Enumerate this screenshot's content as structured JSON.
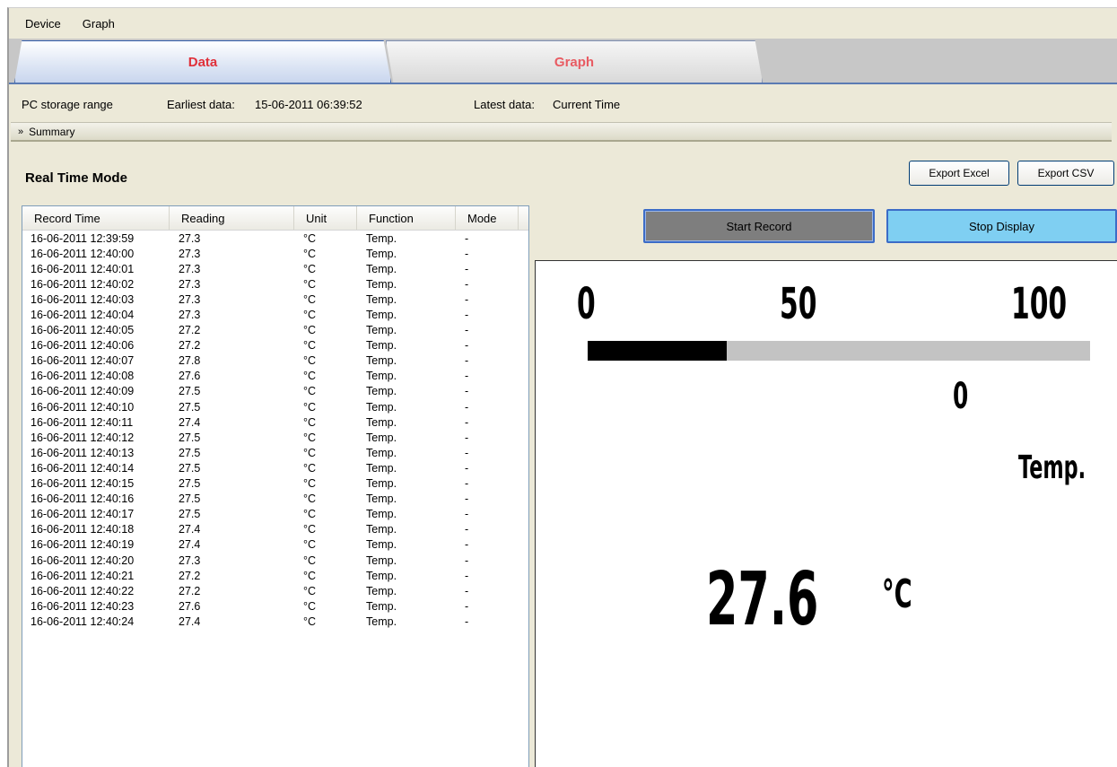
{
  "menu": {
    "items": [
      "Device",
      "Graph"
    ]
  },
  "tabs": {
    "data_label": "Data",
    "graph_label": "Graph"
  },
  "range": {
    "label": "PC storage range",
    "earliest_label": "Earliest data:",
    "earliest_value": "15-06-2011 06:39:52",
    "latest_label": "Latest data:",
    "latest_value": "Current Time"
  },
  "summary": {
    "label": "Summary",
    "chevron": "chevron-double-down-icon"
  },
  "mode_title": "Real Time Mode",
  "buttons": {
    "export_excel": "Export Excel",
    "export_csv": "Export CSV",
    "start_record": "Start Record",
    "stop_display": "Stop Display"
  },
  "table": {
    "columns": [
      "Record Time",
      "Reading",
      "Unit",
      "Function",
      "Mode"
    ],
    "rows": [
      [
        "16-06-2011 12:39:59",
        "27.3",
        "°C",
        "Temp.",
        "-"
      ],
      [
        "16-06-2011 12:40:00",
        "27.3",
        "°C",
        "Temp.",
        "-"
      ],
      [
        "16-06-2011 12:40:01",
        "27.3",
        "°C",
        "Temp.",
        "-"
      ],
      [
        "16-06-2011 12:40:02",
        "27.3",
        "°C",
        "Temp.",
        "-"
      ],
      [
        "16-06-2011 12:40:03",
        "27.3",
        "°C",
        "Temp.",
        "-"
      ],
      [
        "16-06-2011 12:40:04",
        "27.3",
        "°C",
        "Temp.",
        "-"
      ],
      [
        "16-06-2011 12:40:05",
        "27.2",
        "°C",
        "Temp.",
        "-"
      ],
      [
        "16-06-2011 12:40:06",
        "27.2",
        "°C",
        "Temp.",
        "-"
      ],
      [
        "16-06-2011 12:40:07",
        "27.8",
        "°C",
        "Temp.",
        "-"
      ],
      [
        "16-06-2011 12:40:08",
        "27.6",
        "°C",
        "Temp.",
        "-"
      ],
      [
        "16-06-2011 12:40:09",
        "27.5",
        "°C",
        "Temp.",
        "-"
      ],
      [
        "16-06-2011 12:40:10",
        "27.5",
        "°C",
        "Temp.",
        "-"
      ],
      [
        "16-06-2011 12:40:11",
        "27.4",
        "°C",
        "Temp.",
        "-"
      ],
      [
        "16-06-2011 12:40:12",
        "27.5",
        "°C",
        "Temp.",
        "-"
      ],
      [
        "16-06-2011 12:40:13",
        "27.5",
        "°C",
        "Temp.",
        "-"
      ],
      [
        "16-06-2011 12:40:14",
        "27.5",
        "°C",
        "Temp.",
        "-"
      ],
      [
        "16-06-2011 12:40:15",
        "27.5",
        "°C",
        "Temp.",
        "-"
      ],
      [
        "16-06-2011 12:40:16",
        "27.5",
        "°C",
        "Temp.",
        "-"
      ],
      [
        "16-06-2011 12:40:17",
        "27.5",
        "°C",
        "Temp.",
        "-"
      ],
      [
        "16-06-2011 12:40:18",
        "27.4",
        "°C",
        "Temp.",
        "-"
      ],
      [
        "16-06-2011 12:40:19",
        "27.4",
        "°C",
        "Temp.",
        "-"
      ],
      [
        "16-06-2011 12:40:20",
        "27.3",
        "°C",
        "Temp.",
        "-"
      ],
      [
        "16-06-2011 12:40:21",
        "27.2",
        "°C",
        "Temp.",
        "-"
      ],
      [
        "16-06-2011 12:40:22",
        "27.2",
        "°C",
        "Temp.",
        "-"
      ],
      [
        "16-06-2011 12:40:23",
        "27.6",
        "°C",
        "Temp.",
        "-"
      ],
      [
        "16-06-2011 12:40:24",
        "27.4",
        "°C",
        "Temp.",
        "-"
      ]
    ]
  },
  "display": {
    "scale_min": "0",
    "scale_mid": "50",
    "scale_max": "100",
    "bar_fraction": 0.276,
    "sub_value": "0",
    "function": "Temp.",
    "value": "27.6",
    "unit": "°C"
  }
}
